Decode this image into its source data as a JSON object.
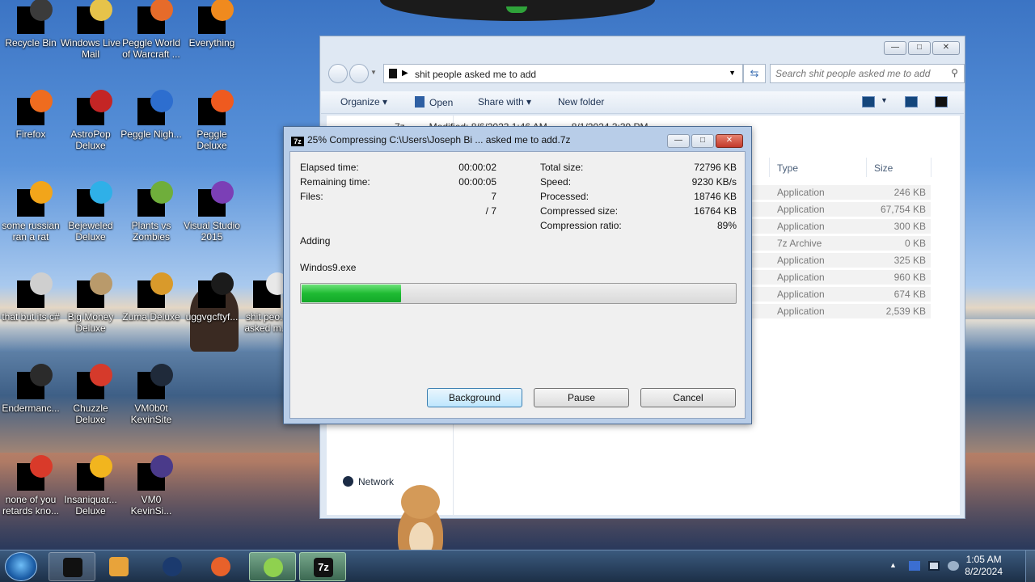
{
  "desktop": {
    "icons": [
      {
        "label": "Recycle Bin",
        "tint": "#3b3b3b"
      },
      {
        "label": "Windows Live Mail",
        "tint": "#e6c34a"
      },
      {
        "label": "Peggle World of Warcraft ...",
        "tint": "#e66b2a"
      },
      {
        "label": "Everything",
        "tint": "#f08a1e"
      },
      {
        "label": "Firefox",
        "tint": "#ef6c1f"
      },
      {
        "label": "AstroPop Deluxe",
        "tint": "#c42525"
      },
      {
        "label": "Peggle Nigh...",
        "tint": "#2d6ecf"
      },
      {
        "label": "Peggle Deluxe",
        "tint": "#ef5a1f"
      },
      {
        "label": "some russian ran a rat",
        "tint": "#f2a51a"
      },
      {
        "label": "Bejeweled Deluxe",
        "tint": "#2fb0e8"
      },
      {
        "label": "Plants vs Zombies",
        "tint": "#6fae3b"
      },
      {
        "label": "Visual Studio 2015",
        "tint": "#7b3fb6"
      },
      {
        "label": "that but its c#",
        "tint": "#cfcfcf"
      },
      {
        "label": "Big Money Deluxe",
        "tint": "#b99a6b"
      },
      {
        "label": "Zuma Deluxe",
        "tint": "#d99a2b"
      },
      {
        "label": "uggvgcftyf...",
        "tint": "#1b1b1b"
      },
      {
        "label": "shit peo... asked m...",
        "tint": "#e8e8e8"
      },
      {
        "label": "Endermanc...",
        "tint": "#2b2b2b"
      },
      {
        "label": "Chuzzle Deluxe",
        "tint": "#d63a2b"
      },
      {
        "label": "VM0b0t KevinSite",
        "tint": "#1f2a3a"
      },
      {
        "label": "none of you retards kno...",
        "tint": "#d93a2a"
      },
      {
        "label": "Insaniquar... Deluxe",
        "tint": "#f2b51e"
      },
      {
        "label": "VM0 KevinSi...",
        "tint": "#4a3a8a"
      }
    ]
  },
  "explorer": {
    "breadcrumb": "shit people asked me to add",
    "search_placeholder": "Search shit people asked me to add",
    "toolbar": {
      "organize": "Organize",
      "open": "Open",
      "share_with": "Share with",
      "new_folder": "New folder"
    },
    "detail_line": "7z ... ... Modified: 8/6/2023 1:46 AM ... ... 8/1/2024 3:39 PM",
    "columns": {
      "type": "Type",
      "size": "Size"
    },
    "rows": [
      {
        "type": "Application",
        "size": "246 KB"
      },
      {
        "type": "Application",
        "size": "67,754 KB"
      },
      {
        "type": "Application",
        "size": "300 KB"
      },
      {
        "type": "7z Archive",
        "size": "0 KB"
      },
      {
        "type": "Application",
        "size": "325 KB"
      },
      {
        "type": "Application",
        "size": "960 KB"
      },
      {
        "type": "Application",
        "size": "674 KB"
      },
      {
        "type": "Application",
        "size": "2,539 KB"
      }
    ],
    "nav": {
      "network": "Network"
    }
  },
  "dialog": {
    "title": "25% Compressing C:\\Users\\Joseph Bi ... asked me to add.7z",
    "icon_text": "7z",
    "left": {
      "elapsed_label": "Elapsed time:",
      "elapsed_value": "00:00:02",
      "remaining_label": "Remaining time:",
      "remaining_value": "00:00:05",
      "files_label": "Files:",
      "files_value": "7",
      "files_total": "/ 7"
    },
    "right": {
      "total_label": "Total size:",
      "total_value": "72796 KB",
      "speed_label": "Speed:",
      "speed_value": "9230 KB/s",
      "processed_label": "Processed:",
      "processed_value": "18746 KB",
      "compressed_label": "Compressed size:",
      "compressed_value": "16764 KB",
      "ratio_label": "Compression ratio:",
      "ratio_value": "89%"
    },
    "status": "Adding",
    "current_file": "Windos9.exe",
    "progress_fraction": 0.23,
    "buttons": {
      "background": "Background",
      "pause": "Pause",
      "cancel": "Cancel"
    }
  },
  "taskbar": {
    "clock_time": "1:05 AM",
    "clock_date": "8/2/2024"
  }
}
